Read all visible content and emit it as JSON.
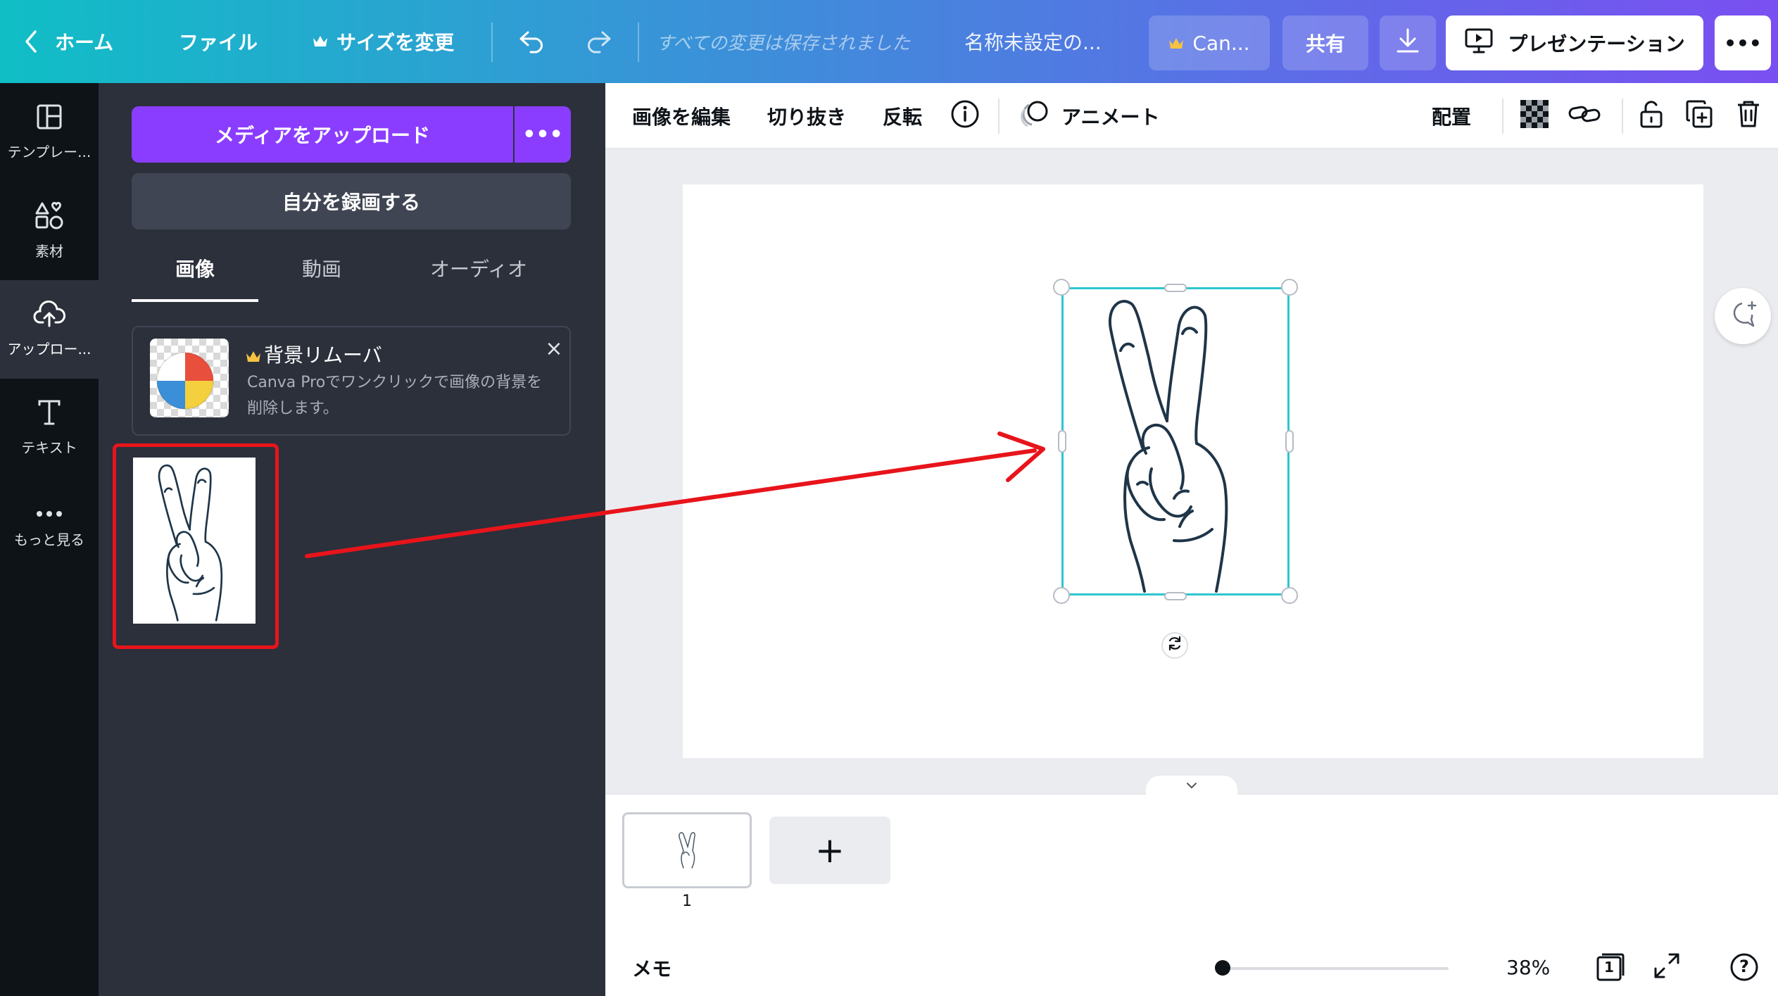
{
  "topbar": {
    "home_label": "ホーム",
    "file_label": "ファイル",
    "resize_label": "サイズを変更",
    "save_status": "すべての変更は保存されました",
    "doc_title": "名称未設定の...",
    "canva_pro_label": "Can...",
    "share_label": "共有",
    "present_label": "プレゼンテーション",
    "more_label": "•••"
  },
  "rail": {
    "items": [
      {
        "label": "テンプレー...",
        "icon": "template-icon"
      },
      {
        "label": "素材",
        "icon": "elements-icon"
      },
      {
        "label": "アップロー...",
        "icon": "upload-cloud-icon"
      },
      {
        "label": "テキスト",
        "icon": "text-icon"
      },
      {
        "label": "もっと見る",
        "icon": "more-dots-icon"
      }
    ]
  },
  "panel": {
    "upload_button": "メディアをアップロード",
    "upload_more": "•••",
    "record_button": "自分を録画する",
    "tabs": [
      "画像",
      "動画",
      "オーディオ"
    ],
    "active_tab": "画像",
    "promo": {
      "title": "背景リムーバ",
      "description": "Canva Proでワンクリックで画像の背景を削除します。",
      "close": "×"
    },
    "uploaded_image": "peace-sign-hand-drawing"
  },
  "context_toolbar": {
    "edit_image": "画像を編集",
    "crop": "切り抜き",
    "flip": "反転",
    "animate": "アニメート",
    "position": "配置"
  },
  "pages": {
    "page_number": "1",
    "add_page": "+"
  },
  "footer": {
    "memo": "メモ",
    "zoom": "38%",
    "zoom_level": 0.38,
    "page_count": "1",
    "help": "?"
  },
  "colors": {
    "accent_purple": "#8b3dff",
    "selection_cyan": "#2ec5cf",
    "annotation_red": "#e8141b",
    "crown_gold": "#f5c242"
  }
}
